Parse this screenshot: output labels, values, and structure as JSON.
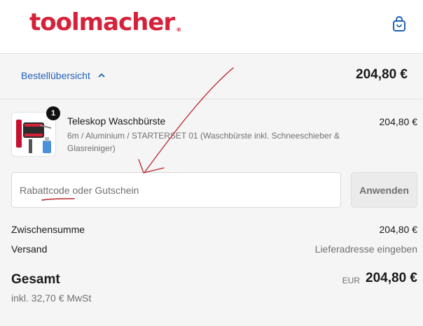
{
  "header": {
    "logo_text": "toolmacher",
    "logo_mark": "®",
    "cart_icon": "shopping-bag-icon"
  },
  "summary_bar": {
    "toggle_label": "Bestellübersicht",
    "toggle_icon": "chevron-up-icon",
    "total": "204,80 €"
  },
  "product": {
    "quantity": "1",
    "name": "Teleskop Waschbürste",
    "variant": "6m / Aluminium / STARTERSET 01 (Waschbürste inkl. Schneeschieber & Glasreiniger)",
    "price": "204,80 €"
  },
  "discount": {
    "placeholder": "Rabattcode oder Gutschein",
    "value": "",
    "apply_label": "Anwenden"
  },
  "totals": {
    "subtotal_label": "Zwischensumme",
    "subtotal_value": "204,80 €",
    "shipping_label": "Versand",
    "shipping_value": "Lieferadresse eingeben",
    "total_label": "Gesamt",
    "currency": "EUR",
    "total_value": "204,80 €",
    "tax_note": "inkl. 32,70 € MwSt"
  },
  "colors": {
    "brand": "#d6213a",
    "link": "#1f5fb8",
    "annotation": "#b8232a"
  }
}
